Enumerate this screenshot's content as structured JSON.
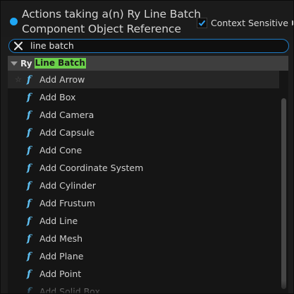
{
  "header": {
    "title_line1": "Actions taking a(n) Ry Line Batch",
    "title_line2": "Component Object Reference",
    "context_sensitive_label": "Context Sensitive",
    "context_sensitive_checked": true
  },
  "search": {
    "value": "line batch"
  },
  "category": {
    "prefix": "Ry",
    "highlight": "Line Batch"
  },
  "items": [
    {
      "label": "Add Arrow"
    },
    {
      "label": "Add Box"
    },
    {
      "label": "Add Camera"
    },
    {
      "label": "Add Capsule"
    },
    {
      "label": "Add Cone"
    },
    {
      "label": "Add Coordinate System"
    },
    {
      "label": "Add Cylinder"
    },
    {
      "label": "Add Frustum"
    },
    {
      "label": "Add Line"
    },
    {
      "label": "Add Mesh"
    },
    {
      "label": "Add Plane"
    },
    {
      "label": "Add Point"
    },
    {
      "label": "Add Solid Box"
    }
  ],
  "colors": {
    "accent": "#1fa7f5",
    "function_icon": "#5fc0f2",
    "highlight": "#6bd14a",
    "search_border": "#1f7bc4"
  }
}
